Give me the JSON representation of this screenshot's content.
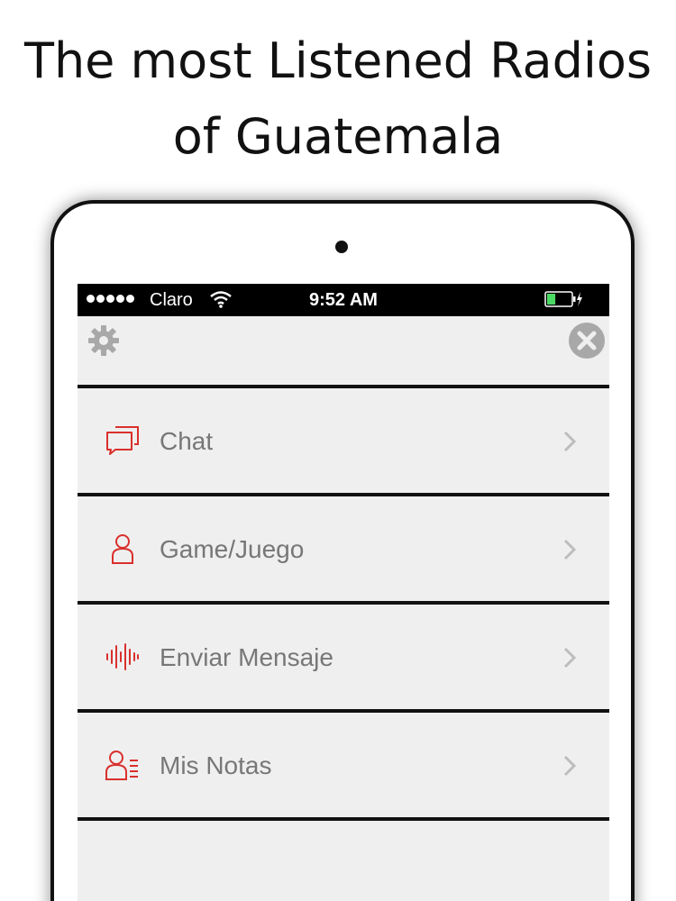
{
  "headline": {
    "line1": "The most Listened Radios",
    "line2": "of Guatemala"
  },
  "status_bar": {
    "carrier": "Claro",
    "time": "9:52 AM",
    "signal_bars": 5,
    "battery_level": 0.35,
    "icons": [
      "signal-dots-icon",
      "wifi-icon",
      "battery-icon",
      "charging-bolt-icon"
    ]
  },
  "toolbar": {
    "left_icon": "gear-icon",
    "right_icon": "close-icon"
  },
  "menu": {
    "items": [
      {
        "label": "Chat",
        "icon": "chat-bubbles-icon"
      },
      {
        "label": "Game/Juego",
        "icon": "user-icon"
      },
      {
        "label": "Enviar Mensaje",
        "icon": "audio-wave-icon"
      },
      {
        "label": "Mis Notas",
        "icon": "user-notes-icon"
      }
    ]
  },
  "colors": {
    "accent": "#d9302c",
    "label": "#777777",
    "screen_bg": "#efeff0",
    "status_bar_bg": "#000000",
    "battery_fill": "#4cd964"
  }
}
